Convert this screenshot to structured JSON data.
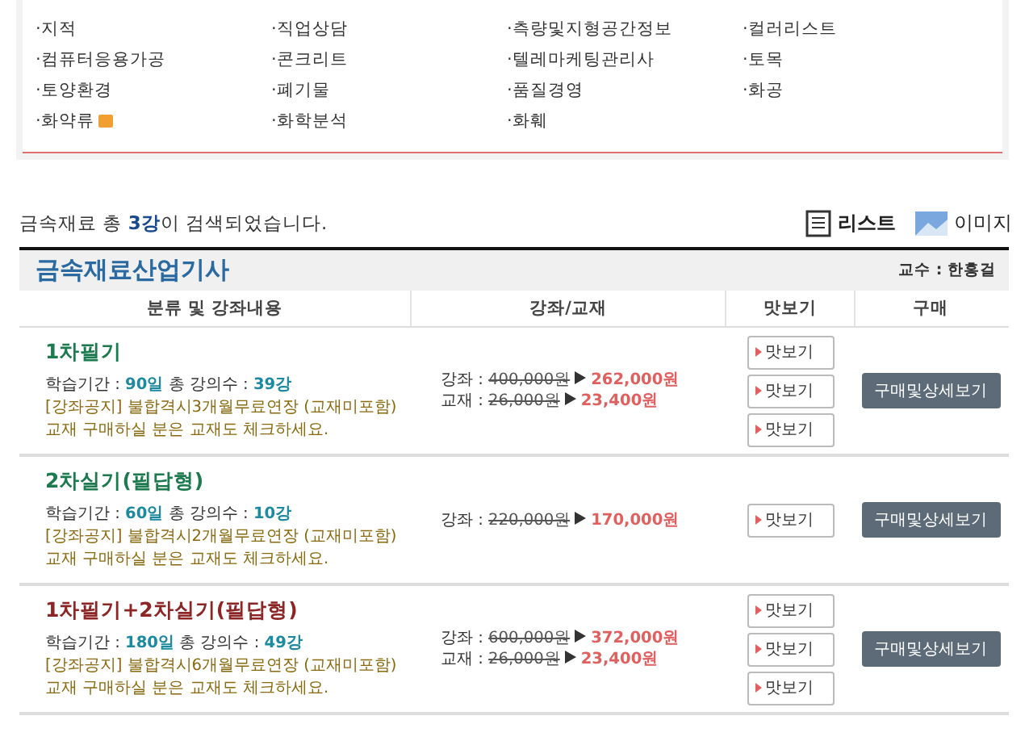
{
  "categories": [
    {
      "label": "·지적",
      "is_new": false
    },
    {
      "label": "·직업상담",
      "is_new": false
    },
    {
      "label": "·측량및지형공간정보",
      "is_new": false
    },
    {
      "label": "·컬러리스트",
      "is_new": false
    },
    {
      "label": "·컴퓨터응용가공",
      "is_new": false
    },
    {
      "label": "·콘크리트",
      "is_new": false
    },
    {
      "label": "·텔레마케팅관리사",
      "is_new": false
    },
    {
      "label": "·토목",
      "is_new": false
    },
    {
      "label": "·토양환경",
      "is_new": false
    },
    {
      "label": "·폐기물",
      "is_new": false
    },
    {
      "label": "·품질경영",
      "is_new": false
    },
    {
      "label": "·화공",
      "is_new": false
    },
    {
      "label": "·화약류",
      "is_new": true
    },
    {
      "label": "·화학분석",
      "is_new": false
    },
    {
      "label": "·화훼",
      "is_new": false
    }
  ],
  "result": "금속재료 총 **3강**이 검색되었습니다.",
  "view_modes": [
    {
      "label": "리스트",
      "kind": "list",
      "selected": true
    },
    {
      "label": "이미지",
      "kind": "image",
      "selected": false
    }
  ],
  "course": {
    "title": "금속재료산업기사",
    "professor": "교수 : 한홍걸",
    "columns": [
      "분류 및 강좌내용",
      "강좌/교재",
      "맛보기",
      "구매"
    ],
    "rows": [
      {
        "name": "1차필기",
        "color": "#1d7a4e",
        "period_label": "학습기간 :",
        "period": "90일",
        "count_label": "총 강의수 :",
        "count": "39강",
        "notice": "[강좌공지] 불합격시3개월무료연장 (교재미포함)",
        "note": "교재 구매하실 분은 교재도 체크하세요.",
        "prices": [
          {
            "label": "강좌 :",
            "old": "400,000원",
            "new": "262,000원"
          },
          {
            "label": "교재 :",
            "old": "26,000원",
            "new": "23,400원"
          }
        ],
        "previews": [
          "맛보기",
          "맛보기",
          "맛보기"
        ],
        "buy": "구매및상세보기"
      },
      {
        "name": "2차실기(필답형)",
        "color": "#1d7a4e",
        "period_label": "학습기간 :",
        "period": "60일",
        "count_label": "총 강의수 :",
        "count": "10강",
        "notice": "[강좌공지] 불합격시2개월무료연장 (교재미포함)",
        "note": "교재 구매하실 분은 교재도 체크하세요.",
        "prices": [
          {
            "label": "강좌 :",
            "old": "220,000원",
            "new": "170,000원"
          }
        ],
        "previews": [
          "맛보기"
        ],
        "buy": "구매및상세보기"
      },
      {
        "name": "1차필기+2차실기(필답형)",
        "color": "#8c2626",
        "period_label": "학습기간 :",
        "period": "180일",
        "count_label": "총 강의수 :",
        "count": "49강",
        "notice": "[강좌공지] 불합격시6개월무료연장 (교재미포함)",
        "note": "교재 구매하실 분은 교재도 체크하세요.",
        "prices": [
          {
            "label": "강좌 :",
            "old": "600,000원",
            "new": "372,000원"
          },
          {
            "label": "교재 :",
            "old": "26,000원",
            "new": "23,400원"
          }
        ],
        "previews": [
          "맛보기",
          "맛보기",
          "맛보기"
        ],
        "buy": "구매및상세보기"
      }
    ]
  }
}
